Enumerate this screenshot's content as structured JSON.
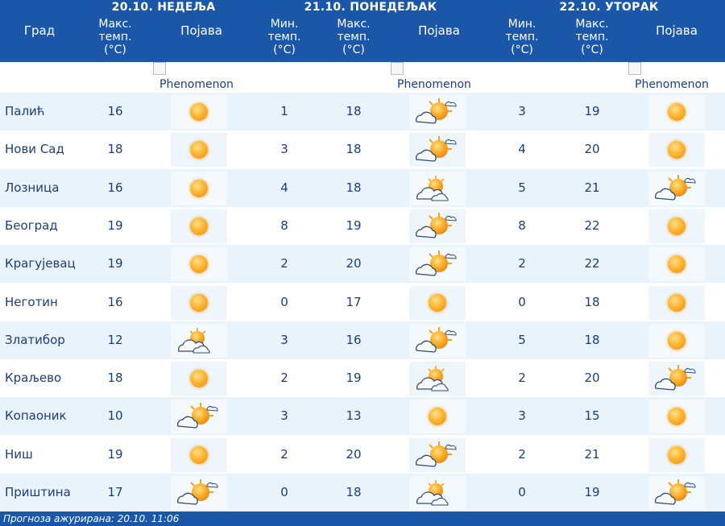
{
  "header": {
    "days": [
      "20.10. НЕДЕЉА",
      "21.10. ПОНЕДЕЉАК",
      "22.10. УТОРАК"
    ],
    "city_col": "Град",
    "min_col": "Мин.\nтемп.\n(°C)",
    "max_col": "Макс.\nтемп.\n(°C)",
    "phen_col": "Појава"
  },
  "legend": {
    "phenomenon_alt": "Phenomenon"
  },
  "rows": [
    {
      "city": "Палић",
      "d1_max": "16",
      "d1_icon": "sun-icon",
      "d2_min": "1",
      "d2_max": "18",
      "d2_icon": "partly-cloudy-icon",
      "d3_min": "3",
      "d3_max": "19",
      "d3_icon": "sun-icon"
    },
    {
      "city": "Нови Сад",
      "d1_max": "18",
      "d1_icon": "sun-icon",
      "d2_min": "3",
      "d2_max": "18",
      "d2_icon": "partly-cloudy-icon",
      "d3_min": "4",
      "d3_max": "20",
      "d3_icon": "sun-icon"
    },
    {
      "city": "Лозница",
      "d1_max": "16",
      "d1_icon": "sun-icon",
      "d2_min": "4",
      "d2_max": "18",
      "d2_icon": "cloudy-sun-icon",
      "d3_min": "5",
      "d3_max": "21",
      "d3_icon": "partly-cloudy-icon"
    },
    {
      "city": "Београд",
      "d1_max": "19",
      "d1_icon": "sun-icon",
      "d2_min": "8",
      "d2_max": "19",
      "d2_icon": "partly-cloudy-icon",
      "d3_min": "8",
      "d3_max": "22",
      "d3_icon": "sun-icon"
    },
    {
      "city": "Крагујевац",
      "d1_max": "19",
      "d1_icon": "sun-icon",
      "d2_min": "2",
      "d2_max": "20",
      "d2_icon": "partly-cloudy-icon",
      "d3_min": "2",
      "d3_max": "22",
      "d3_icon": "sun-icon"
    },
    {
      "city": "Неготин",
      "d1_max": "16",
      "d1_icon": "sun-icon",
      "d2_min": "0",
      "d2_max": "17",
      "d2_icon": "sun-icon",
      "d3_min": "0",
      "d3_max": "18",
      "d3_icon": "sun-icon"
    },
    {
      "city": "Златибор",
      "d1_max": "12",
      "d1_icon": "cloudy-sun-icon",
      "d2_min": "3",
      "d2_max": "16",
      "d2_icon": "partly-cloudy-icon",
      "d3_min": "5",
      "d3_max": "18",
      "d3_icon": "sun-icon"
    },
    {
      "city": "Краљево",
      "d1_max": "18",
      "d1_icon": "sun-icon",
      "d2_min": "2",
      "d2_max": "19",
      "d2_icon": "cloudy-sun-icon",
      "d3_min": "2",
      "d3_max": "20",
      "d3_icon": "partly-cloudy-icon"
    },
    {
      "city": "Копаоник",
      "d1_max": "10",
      "d1_icon": "partly-cloudy-icon",
      "d2_min": "3",
      "d2_max": "13",
      "d2_icon": "sun-icon",
      "d3_min": "3",
      "d3_max": "15",
      "d3_icon": "sun-icon"
    },
    {
      "city": "Ниш",
      "d1_max": "19",
      "d1_icon": "sun-icon",
      "d2_min": "2",
      "d2_max": "20",
      "d2_icon": "partly-cloudy-icon",
      "d3_min": "2",
      "d3_max": "21",
      "d3_icon": "sun-icon"
    },
    {
      "city": "Приштина",
      "d1_max": "17",
      "d1_icon": "partly-cloudy-icon",
      "d2_min": "0",
      "d2_max": "18",
      "d2_icon": "cloudy-sun-icon",
      "d3_min": "0",
      "d3_max": "19",
      "d3_icon": "partly-cloudy-icon"
    }
  ],
  "footer": {
    "text": "Прогноза ажурирана:  20.10.  11:06"
  },
  "colors": {
    "header_bg": "#1a57a8",
    "text": "#1c3d78",
    "row_alt": "#e9f3fb"
  }
}
